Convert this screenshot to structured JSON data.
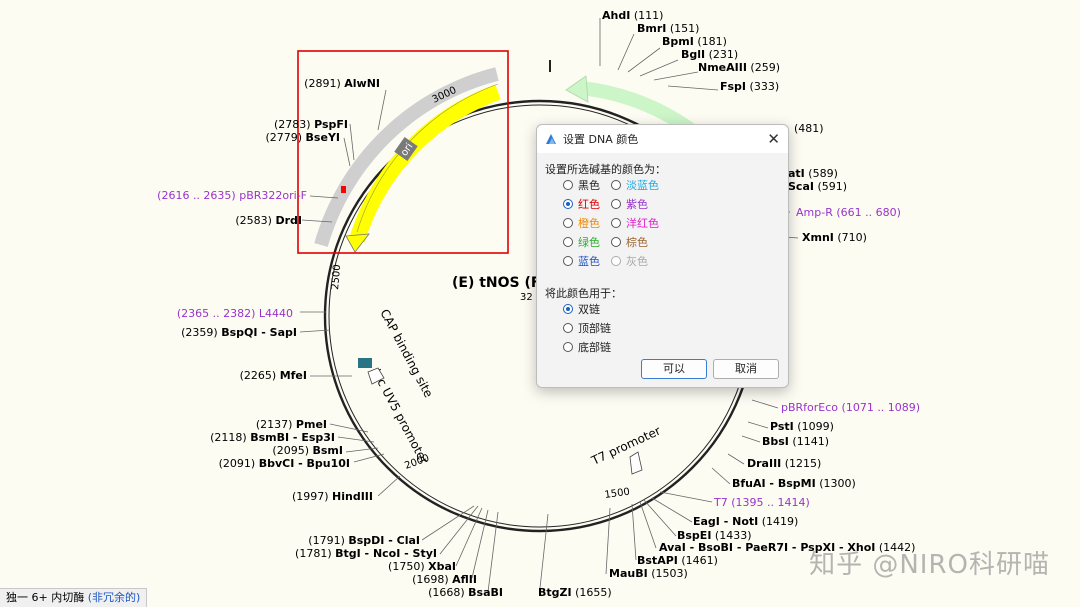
{
  "map": {
    "center_title": "(E) tNOS (F",
    "center_sub": "32",
    "ruler": [
      "3000",
      "2500",
      "2000",
      "1500"
    ],
    "sites": [
      {
        "name": "AhdI",
        "pos": "(111)"
      },
      {
        "name": "BmrI",
        "pos": "(151)"
      },
      {
        "name": "BpmI",
        "pos": "(181)"
      },
      {
        "name": "BglI",
        "pos": "(231)"
      },
      {
        "name": "NmeAIII",
        "pos": "(259)"
      },
      {
        "name": "FspI",
        "pos": "(333)"
      },
      {
        "name": "",
        "pos": "(481)"
      },
      {
        "name": "atI",
        "pos": "(589)"
      },
      {
        "name": "ScaI",
        "pos": "(591)"
      },
      {
        "name": "XmnI",
        "pos": "(710)"
      },
      {
        "name": "PstI",
        "pos": "(1099)"
      },
      {
        "name": "BbsI",
        "pos": "(1141)"
      },
      {
        "name": "DraIII",
        "pos": "(1215)"
      },
      {
        "name": "BfuAI - BspMI",
        "pos": "(1300)"
      },
      {
        "name": "EagI - NotI",
        "pos": "(1419)"
      },
      {
        "name": "BspEI",
        "pos": "(1433)"
      },
      {
        "name": "AvaI - BsoBI - PaeR7I - PspXI - XhoI",
        "pos": "(1442)"
      },
      {
        "name": "BstAPI",
        "pos": "(1461)"
      },
      {
        "name": "MauBI",
        "pos": "(1503)"
      },
      {
        "name": "BtgZI",
        "pos": "(1655)"
      },
      {
        "name": "BsaBI",
        "pos": "(1668)"
      },
      {
        "name": "AflII",
        "pos": "(1698)"
      },
      {
        "name": "XbaI",
        "pos": "(1750)"
      },
      {
        "name": "BtgI - NcoI - StyI",
        "pos": "(1781)"
      },
      {
        "name": "BspDI - ClaI",
        "pos": "(1791)"
      },
      {
        "name": "HindIII",
        "pos": "(1997)"
      },
      {
        "name": "BbvCI - Bpu10I",
        "pos": "(2091)"
      },
      {
        "name": "BsmI",
        "pos": "(2095)"
      },
      {
        "name": "BsmBI - Esp3I",
        "pos": "(2118)"
      },
      {
        "name": "PmeI",
        "pos": "(2137)"
      },
      {
        "name": "MfeI",
        "pos": "(2265)"
      },
      {
        "name": "BspQI - SapI",
        "pos": "(2359)"
      },
      {
        "name": "DrdI",
        "pos": "(2583)"
      },
      {
        "name": "BseYI",
        "pos": "(2779)"
      },
      {
        "name": "PspFI",
        "pos": "(2783)"
      },
      {
        "name": "AlwNI",
        "pos": "(2891)"
      }
    ],
    "features": [
      {
        "name": "Amp-R",
        "range": "(661 .. 680)"
      },
      {
        "name": "pBRforEco",
        "range": "(1071 .. 1089)"
      },
      {
        "name": "T7",
        "range": "(1395 .. 1414)"
      },
      {
        "name": "L4440",
        "range": "(2365 .. 2382)"
      },
      {
        "name": "pBR322ori-F",
        "range": "(2616 .. 2635)"
      }
    ],
    "inner_labels": {
      "ori": "ori",
      "cap": "CAP binding site",
      "lac": "lac UV5 promoter",
      "t7": "T7 promoter"
    },
    "colors": {
      "ori_feature": "#ffff00",
      "amp_arrow": "#ccf5c8",
      "feature_text": "#9933cc",
      "selection_box": "#e00000",
      "selected_base": "#ff0000"
    }
  },
  "dialog": {
    "title": "设置 DNA 颜色",
    "prompt": "设置所选碱基的颜色为：",
    "colors": [
      {
        "label": "黑色",
        "color": "#222222"
      },
      {
        "label": "淡蓝色",
        "color": "#22aadd"
      },
      {
        "label": "红色",
        "color": "#dd0000"
      },
      {
        "label": "紫色",
        "color": "#9933cc"
      },
      {
        "label": "橙色",
        "color": "#ee8800"
      },
      {
        "label": "洋红色",
        "color": "#dd22cc"
      },
      {
        "label": "绿色",
        "color": "#33aa33"
      },
      {
        "label": "棕色",
        "color": "#996633"
      },
      {
        "label": "蓝色",
        "color": "#2255cc"
      },
      {
        "label": "灰色",
        "color": "#aaaaaa"
      }
    ],
    "selected_color": "红色",
    "apply_prompt": "将此颜色用于：",
    "apply_options": [
      "双链",
      "顶部链",
      "底部链"
    ],
    "selected_apply": "双链",
    "ok_label": "可以",
    "cancel_label": "取消"
  },
  "status": {
    "text": "独一 6+ 内切酶",
    "nonredundant": "(非冗余的)"
  },
  "watermark": "知乎 @NIRO科研喵"
}
